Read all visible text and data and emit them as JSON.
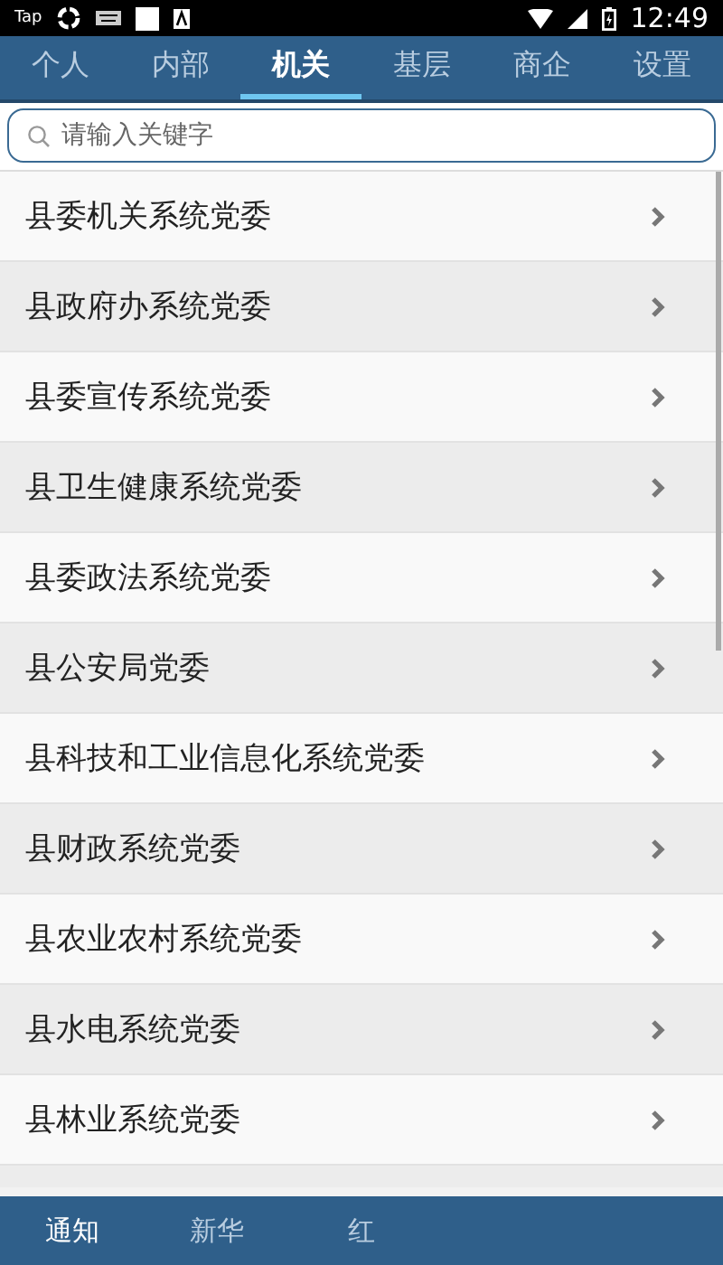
{
  "status_bar": {
    "app_label": "Tap",
    "time": "12:49"
  },
  "tabs": [
    {
      "label": "个人",
      "selected": false
    },
    {
      "label": "内部",
      "selected": false
    },
    {
      "label": "机关",
      "selected": true
    },
    {
      "label": "基层",
      "selected": false
    },
    {
      "label": "商企",
      "selected": false
    },
    {
      "label": "设置",
      "selected": false
    }
  ],
  "search": {
    "placeholder": "请输入关键字"
  },
  "list": {
    "items": [
      {
        "label": "县委机关系统党委"
      },
      {
        "label": "县政府办系统党委"
      },
      {
        "label": "县委宣传系统党委"
      },
      {
        "label": "县卫生健康系统党委"
      },
      {
        "label": "县委政法系统党委"
      },
      {
        "label": "县公安局党委"
      },
      {
        "label": "县科技和工业信息化系统党委"
      },
      {
        "label": "县财政系统党委"
      },
      {
        "label": "县农业农村系统党委"
      },
      {
        "label": "县水电系统党委"
      },
      {
        "label": "县林业系统党委"
      }
    ]
  },
  "bottom_nav": [
    {
      "label": "通知",
      "selected": true
    },
    {
      "label": "新华",
      "selected": false
    },
    {
      "label": "红",
      "selected": false
    }
  ]
}
